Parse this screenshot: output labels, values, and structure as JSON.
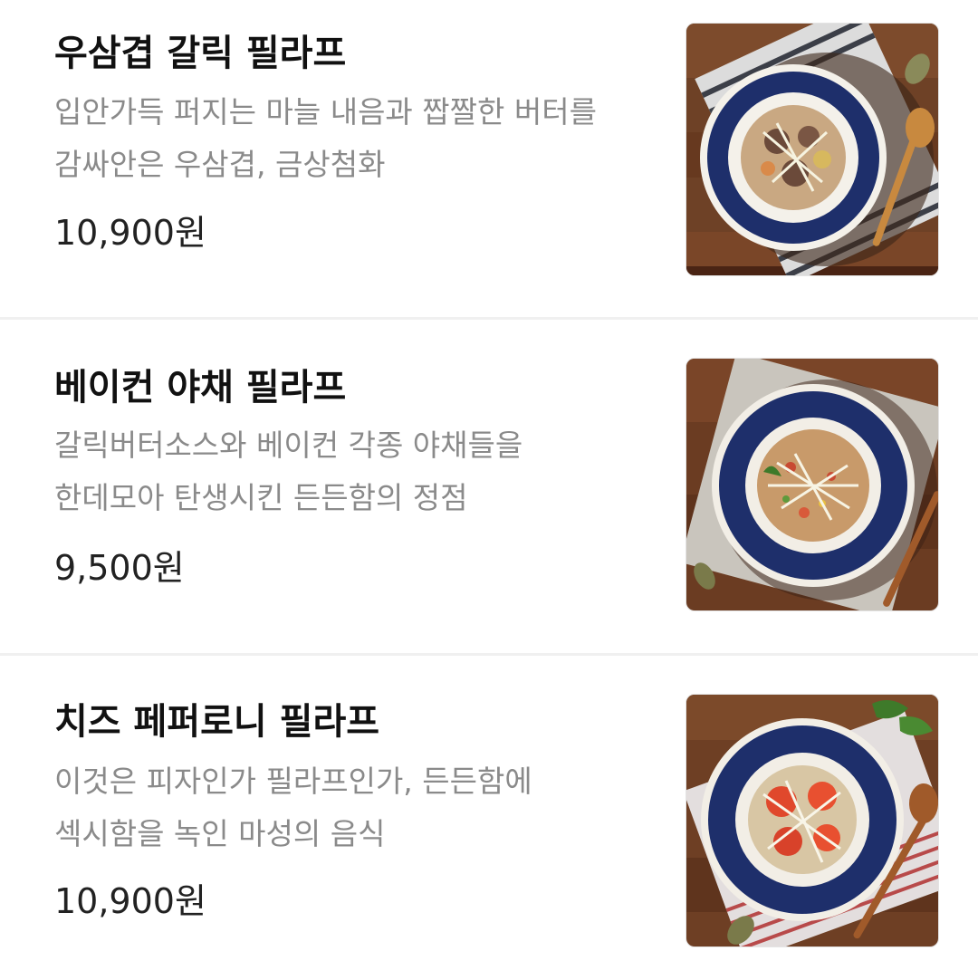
{
  "menu": {
    "items": [
      {
        "name": "우삼겹 갈릭 필라프",
        "desc_line1": "입안가득 퍼지는 마늘 내음과 짭짤한 버터를",
        "desc_line2": "감싸안은 우삼겹, 금상첨화",
        "price": "10,900원",
        "image_icon": "garlic-beef-pilaf-photo"
      },
      {
        "name": "베이컨 야채 필라프",
        "desc_line1": "갈릭버터소스와 베이컨 각종 야채들을",
        "desc_line2": "한데모아 탄생시킨 든든함의 정점",
        "price": "9,500원",
        "image_icon": "bacon-vegetable-pilaf-photo"
      },
      {
        "name": "치즈 페퍼로니 필라프",
        "desc_line1": "이것은 피자인가 필라프인가, 든든함에",
        "desc_line2": "섹시함을 녹인 마성의 음식",
        "price": "10,900원",
        "image_icon": "cheese-pepperoni-pilaf-photo"
      }
    ]
  },
  "colors": {
    "name": "#111111",
    "description": "#8a8a8a",
    "price": "#222222",
    "divider": "#f0f0f0",
    "plate_rim": "#1e2f6b",
    "wood": "#7a4a2a"
  }
}
